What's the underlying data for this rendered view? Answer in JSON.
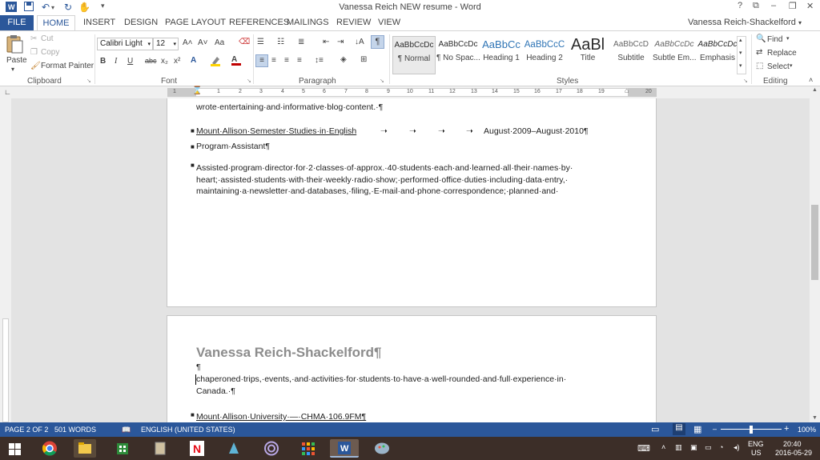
{
  "window": {
    "title": "Vanessa Reich NEW resume - Word",
    "help_glyph": "?",
    "restore_glyph": "⧉",
    "minimize_glyph": "–",
    "maximize_glyph": "❐",
    "close_glyph": "✕"
  },
  "quick_access": {
    "save_icon": "save-icon",
    "undo_glyph": "↶",
    "redo_glyph": "↻",
    "touch_glyph": "✋",
    "customize_glyph": "▾"
  },
  "tabs": {
    "file": "FILE",
    "items": [
      "HOME",
      "INSERT",
      "DESIGN",
      "PAGE LAYOUT",
      "REFERENCES",
      "MAILINGS",
      "REVIEW",
      "VIEW"
    ]
  },
  "user": "Vanessa Reich-Shackelford",
  "user_chevron": "▾",
  "ribbon": {
    "clipboard": {
      "label": "Clipboard",
      "paste": "Paste",
      "cut": "Cut",
      "copy": "Copy",
      "format_painter": "Format Painter"
    },
    "font": {
      "label": "Font",
      "font_name": "Calibri Light",
      "font_size": "12",
      "bold": "B",
      "italic": "I",
      "underline": "U",
      "strike": "abc",
      "subscript": "x₂",
      "superscript": "x²",
      "grow": "A˄",
      "shrink": "A˅",
      "case": "Aa",
      "effects": "A",
      "font_color": "A"
    },
    "paragraph": {
      "label": "Paragraph",
      "show_marks": "¶",
      "sort": "↓A"
    },
    "styles": {
      "label": "Styles",
      "items": [
        {
          "preview": "AaBbCcDc",
          "name": "¶ Normal"
        },
        {
          "preview": "AaBbCcDc",
          "name": "¶ No Spac..."
        },
        {
          "preview": "AaBbCc",
          "name": "Heading 1"
        },
        {
          "preview": "AaBbCcC",
          "name": "Heading 2"
        },
        {
          "preview": "AaBl",
          "name": "Title"
        },
        {
          "preview": "AaBbCcD",
          "name": "Subtitle"
        },
        {
          "preview": "AaBbCcDc",
          "name": "Subtle Em..."
        },
        {
          "preview": "AaBbCcDc",
          "name": "Emphasis"
        }
      ]
    },
    "editing": {
      "label": "Editing",
      "find": "Find",
      "replace": "Replace",
      "select": "Select"
    }
  },
  "ruler_numbers": [
    "1",
    "1",
    "2",
    "3",
    "4",
    "5",
    "6",
    "7",
    "8",
    "9",
    "10",
    "11",
    "12",
    "13",
    "14",
    "15",
    "16",
    "17",
    "18",
    "19",
    "20"
  ],
  "document": {
    "page1": {
      "line_top": "wrote·entertaining·and·informative·blog·content.·¶",
      "job1_title": "Mount·Allison·Semester·Studies·in·English",
      "job1_dates": "August·2009–August·2010¶",
      "job1_role": "Program·Assistant¶",
      "job1_desc_1": "Assisted·program·director·for·2·classes·of·approx.·40·students·each·and·learned·all·their·names·by·",
      "job1_desc_2": "heart;·assisted·students·with·their·weekly·radio·show;·performed·office·duties·including·data·entry,·",
      "job1_desc_3": "maintaining·a·newsletter·and·databases,·filing,·E-mail·and·phone·correspondence;·planned·and·"
    },
    "page2": {
      "heading": "Vanessa Reich-Shackelford¶",
      "empty_mark": "¶",
      "desc_1": "chaperoned·trips,·events,·and·activities·for·students·to·have·a·well-rounded·and·full·experience·in·",
      "desc_2": "Canada.·¶",
      "job2_title": "Mount·Allison·University·—·CHMA·106.9FM¶"
    },
    "arrow": "➝",
    "bullet": "■"
  },
  "status": {
    "page": "PAGE 2 OF 2",
    "words": "501 WORDS",
    "language": "ENGLISH (UNITED STATES)",
    "zoom": "100%",
    "zoom_level": 1.0,
    "minus": "–",
    "plus": "+"
  },
  "taskbar": {
    "lang": "ENG",
    "region": "US",
    "time": "20:40",
    "date": "2016-05-29",
    "apps": [
      "start-icon",
      "chrome-icon",
      "file-explorer-icon",
      "store-icon",
      "notepad-icon",
      "netflix-icon",
      "app-icon",
      "itunes-icon",
      "grid-app-icon",
      "word-icon",
      "paint-icon"
    ]
  },
  "colors": {
    "accent": "#2b579a",
    "taskbar": "#3c2e28",
    "netflix": "#e50914",
    "store": "#2e8b3a"
  }
}
